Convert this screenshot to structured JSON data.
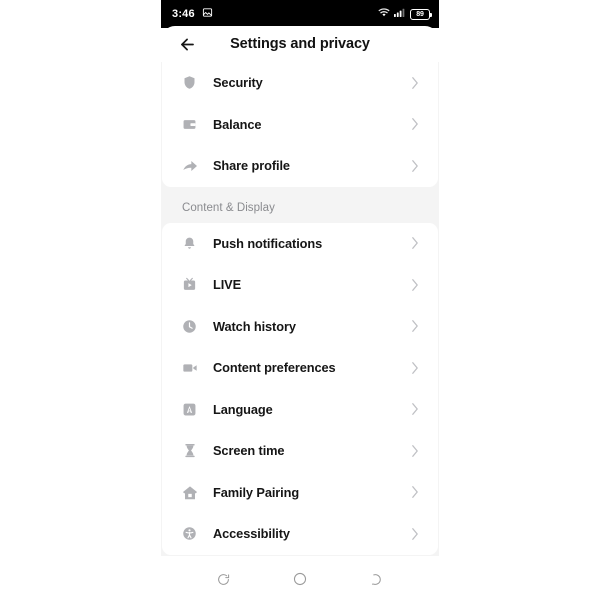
{
  "status_bar": {
    "time": "3:46",
    "photo_icon": "image-icon",
    "wifi_icon": "wifi-icon",
    "signal_icon": "cellular-signal-icon",
    "battery_icon": "battery-icon",
    "battery_level": "89"
  },
  "header": {
    "back_icon": "back-arrow-icon",
    "title": "Settings and privacy"
  },
  "sections": [
    {
      "header": "",
      "items": [
        {
          "label": "Security",
          "icon": "shield-icon",
          "chevron": "chevron-right-icon"
        },
        {
          "label": "Balance",
          "icon": "wallet-icon",
          "chevron": "chevron-right-icon"
        },
        {
          "label": "Share profile",
          "icon": "share-arrow-icon",
          "chevron": "chevron-right-icon"
        }
      ]
    },
    {
      "header": "Content & Display",
      "items": [
        {
          "label": "Push notifications",
          "icon": "bell-icon",
          "chevron": "chevron-right-icon"
        },
        {
          "label": "LIVE",
          "icon": "live-video-icon",
          "chevron": "chevron-right-icon"
        },
        {
          "label": "Watch history",
          "icon": "clock-icon",
          "chevron": "chevron-right-icon"
        },
        {
          "label": "Content preferences",
          "icon": "video-camera-icon",
          "chevron": "chevron-right-icon"
        },
        {
          "label": "Language",
          "icon": "language-a-icon",
          "chevron": "chevron-right-icon"
        },
        {
          "label": "Screen time",
          "icon": "hourglass-icon",
          "chevron": "chevron-right-icon"
        },
        {
          "label": "Family Pairing",
          "icon": "house-icon",
          "chevron": "chevron-right-icon"
        },
        {
          "label": "Accessibility",
          "icon": "accessibility-icon",
          "chevron": "chevron-right-icon"
        }
      ]
    }
  ],
  "nav_bar": {
    "recents_icon": "recents-icon",
    "home_icon": "home-circle-icon",
    "back_icon": "back-nav-icon"
  },
  "colors": {
    "status_bar_bg": "#000000",
    "page_bg": "#f4f4f4",
    "card_bg": "#ffffff",
    "text_primary": "#161616",
    "text_secondary": "#8a8b8f",
    "icon_gray": "#b0b1b5",
    "chevron_gray": "#bfc0c4"
  }
}
